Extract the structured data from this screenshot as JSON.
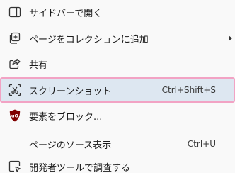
{
  "menu": {
    "items": [
      {
        "label": "サイドバーで開く",
        "icon": "sidebar-icon"
      },
      {
        "label": "ページをコレクションに追加",
        "icon": "collections-add-icon",
        "submenu": true
      },
      {
        "label": "共有",
        "icon": "share-icon"
      },
      {
        "label": "スクリーンショット",
        "icon": "screenshot-icon",
        "shortcut": "Ctrl+Shift+S",
        "highlighted": true
      },
      {
        "label": "要素をブロック...",
        "icon": "ublock-origin-icon"
      },
      {
        "label": "ページのソース表示",
        "shortcut": "Ctrl+U"
      },
      {
        "label": "開発者ツールで調査する",
        "icon": "devtools-inspect-icon"
      }
    ]
  },
  "colors": {
    "highlight_background": "#dde7f1",
    "highlight_border": "#f2a3c4",
    "ublock_red": "#800000"
  }
}
